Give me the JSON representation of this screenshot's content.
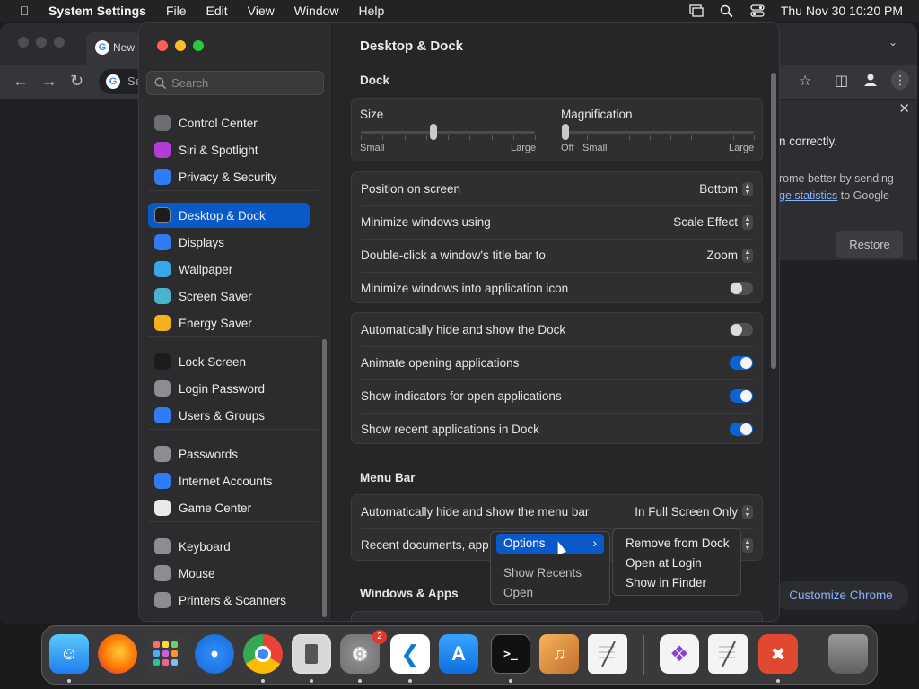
{
  "menubar": {
    "app_name": "System Settings",
    "items": [
      "File",
      "Edit",
      "View",
      "Window",
      "Help"
    ],
    "clock": "Thu Nov 30  10:20 PM"
  },
  "chrome": {
    "tab_title": "New",
    "omnibox_text": "Se",
    "infobar": {
      "line1": "n correctly.",
      "line2": "rome better by sending",
      "link": "ge statistics",
      "line3_tail": " to Google",
      "restore_label": "Restore"
    },
    "customize_label": "Customize Chrome"
  },
  "settings": {
    "search_placeholder": "Search",
    "sidebar": [
      {
        "label": "Control Center",
        "icon": "control-center-icon",
        "color": "#6e6e72"
      },
      {
        "label": "Siri & Spotlight",
        "icon": "siri-icon",
        "color": "#b43bd6"
      },
      {
        "label": "Privacy & Security",
        "icon": "hand-icon",
        "color": "#2f7cf6"
      },
      {
        "label": "Desktop & Dock",
        "icon": "dock-icon",
        "color": "#1c1c1e",
        "active": true
      },
      {
        "label": "Displays",
        "icon": "sun-icon",
        "color": "#2f7cf6"
      },
      {
        "label": "Wallpaper",
        "icon": "flower-icon",
        "color": "#39a7e8"
      },
      {
        "label": "Screen Saver",
        "icon": "screensaver-icon",
        "color": "#4bb3c9"
      },
      {
        "label": "Energy Saver",
        "icon": "bulb-icon",
        "color": "#f2b01e"
      },
      {
        "label": "Lock Screen",
        "icon": "lock-icon",
        "color": "#1c1c1e"
      },
      {
        "label": "Login Password",
        "icon": "padlock-icon",
        "color": "#8d8d91"
      },
      {
        "label": "Users & Groups",
        "icon": "users-icon",
        "color": "#2f7cf6"
      },
      {
        "label": "Passwords",
        "icon": "key-icon",
        "color": "#8d8d91"
      },
      {
        "label": "Internet Accounts",
        "icon": "at-icon",
        "color": "#2f7cf6"
      },
      {
        "label": "Game Center",
        "icon": "game-center-icon",
        "color": "#e9e9eb"
      },
      {
        "label": "Keyboard",
        "icon": "keyboard-icon",
        "color": "#8d8d91"
      },
      {
        "label": "Mouse",
        "icon": "mouse-icon",
        "color": "#8d8d91"
      },
      {
        "label": "Printers & Scanners",
        "icon": "printer-icon",
        "color": "#8d8d91"
      }
    ],
    "title": "Desktop & Dock",
    "dock_section": "Dock",
    "size_label": "Size",
    "size_small": "Small",
    "size_large": "Large",
    "size_value": 0.42,
    "mag_label": "Magnification",
    "mag_off": "Off",
    "mag_small": "Small",
    "mag_large": "Large",
    "mag_value": 0.0,
    "position_label": "Position on screen",
    "position_value": "Bottom",
    "minimize_label": "Minimize windows using",
    "minimize_value": "Scale Effect",
    "doubleclick_label": "Double-click a window's title bar to",
    "doubleclick_value": "Zoom",
    "minimize_icon_label": "Minimize windows into application icon",
    "autohide_label": "Automatically hide and show the Dock",
    "animate_label": "Animate opening applications",
    "indicators_label": "Show indicators for open applications",
    "recent_label": "Show recent applications in Dock",
    "menubar_section": "Menu Bar",
    "menubar_hide_label": "Automatically hide and show the menu bar",
    "menubar_hide_value": "In Full Screen Only",
    "recent_docs_label": "Recent documents, app",
    "windows_section": "Windows & Apps"
  },
  "context_menu": {
    "options": "Options",
    "show_recents": "Show Recents",
    "open": "Open",
    "sub": [
      "Remove from Dock",
      "Open at Login",
      "Show in Finder"
    ]
  },
  "dock": {
    "settings_badge": "2"
  }
}
